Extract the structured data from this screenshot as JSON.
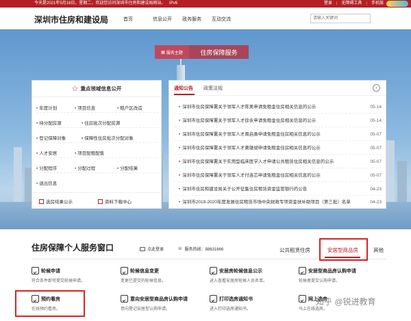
{
  "topbar": {
    "greeting": "今天是2021年5月18日，星期二，欢迎您访问深圳市住房和建设局网站。",
    "ipv6": "IPv6",
    "links": [
      "登录",
      "无障碍工具",
      "手机版"
    ]
  },
  "header": {
    "site_title": "深圳市住房和建设局",
    "nav": [
      "首页",
      "信息公开",
      "政务服务",
      "互动交流"
    ],
    "search_placeholder": "请输入关键词"
  },
  "theme": {
    "tag": "服务主题",
    "title": "住房保障服务"
  },
  "focus_panel": {
    "title": "重点领域信息公开",
    "rows": [
      [
        "年度计划",
        "项目信息",
        "租户区改造"
      ],
      [
        "待分配房源",
        "住房批次分配房源"
      ],
      [
        "登记保障对象",
        "保障性住房批次分配对象"
      ],
      [
        "人才安居",
        "项目配租配售"
      ],
      [
        "分配程序",
        "分配过程",
        "分配结果"
      ],
      [
        "退出信息"
      ]
    ],
    "footer": [
      "选房结果公示",
      "资料下载中心"
    ]
  },
  "news_panel": {
    "tabs": [
      "通知公告",
      "政策法规"
    ],
    "more": "›",
    "items": [
      {
        "title": "深圳市住房保障署关于领军人才陈奥申请免租金住房相关信息的公示",
        "date": "05-14"
      },
      {
        "title": "深圳市住房保障署关于领军人才徐永申请免租金住房相关信息的公示",
        "date": "05-14"
      },
      {
        "title": "深圳市住房保障署关于领军人才周启勇申请免租金住房相关信息的公示",
        "date": "05-07"
      },
      {
        "title": "深圳市住房保障署关于领军人才黄雄斌申请免租金住房相关信息的公示",
        "date": "05-07"
      },
      {
        "title": "深圳市住房保障署关于实用型临床医学人才申请公共租赁住房相关信息的公示",
        "date": "05-07"
      },
      {
        "title": "深圳市住房保障署关于领军人才付连芯申请免租金住房相关信息的公示",
        "date": "05-07"
      },
      {
        "title": "深圳市住房和建设局关于公开征集住房租赁资金监管银行的公告",
        "date": "04-23"
      },
      {
        "title": "深圳市2019-2020年度发展住房租赁市场中央财政专项资金扶补助项目（第三批）名单",
        "date": "04-23"
      }
    ]
  },
  "service": {
    "title": "住房保障个人服务窗口",
    "login": "点此登录",
    "phone": "服务热线：88631666",
    "tabs": [
      "公共租赁住房",
      "安居型商品房",
      "其他"
    ],
    "cards": [
      {
        "title": "轮候申请",
        "desc": "符合条件即可提交轮候申请。"
      },
      {
        "title": "轮候信息变更",
        "desc": "变更已提交的轮候信息。"
      },
      {
        "title": "安居房轮候信息公示",
        "desc": "进入查看安居房轮候人员名单。"
      },
      {
        "title": "安居型商品房认购申请",
        "desc": "轮候者提交认购申请。"
      },
      {
        "title": "预约看房",
        "desc": "在线预约看房。"
      },
      {
        "title": "意向安居型商品房认购申请",
        "desc": "意向登记安居型认购申请。"
      },
      {
        "title": "打印选房通知书",
        "desc": "进入打印选房通知书。"
      },
      {
        "title": "网上选房",
        "desc": "马上在线选房。"
      }
    ]
  },
  "watermark": {
    "text": "知乎 @锐进教育"
  }
}
